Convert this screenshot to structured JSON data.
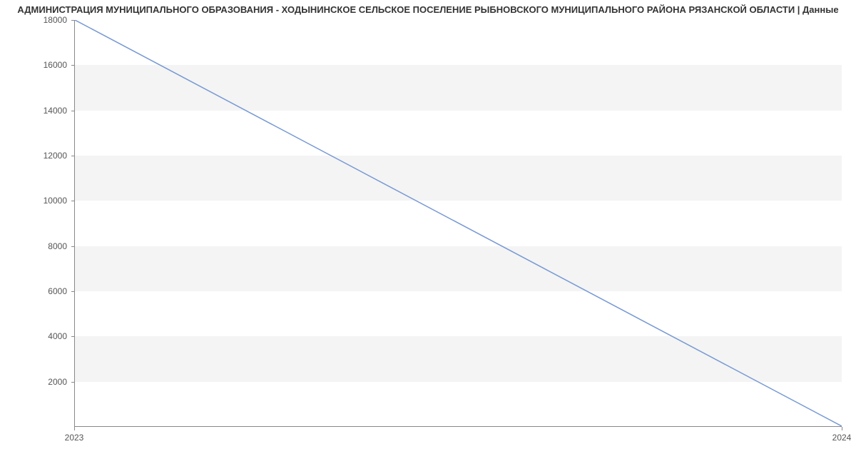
{
  "title": "АДМИНИСТРАЦИЯ МУНИЦИПАЛЬНОГО ОБРАЗОВАНИЯ - ХОДЫНИНСКОЕ СЕЛЬСКОЕ ПОСЕЛЕНИЕ РЫБНОВСКОГО МУНИЦИПАЛЬНОГО РАЙОНА РЯЗАНСКОЙ ОБЛАСТИ | Данные",
  "chart_data": {
    "type": "line",
    "x": [
      2023,
      2024
    ],
    "values": [
      18000,
      0
    ],
    "xlabel": "",
    "ylabel": "",
    "xlim": [
      2023,
      2024
    ],
    "ylim": [
      0,
      18000
    ],
    "y_ticks": [
      2000,
      4000,
      6000,
      8000,
      10000,
      12000,
      14000,
      16000,
      18000
    ],
    "x_ticks": [
      2023,
      2024
    ],
    "bands": [
      [
        2000,
        4000
      ],
      [
        6000,
        8000
      ],
      [
        10000,
        12000
      ],
      [
        14000,
        16000
      ]
    ],
    "line_color": "#7699d4"
  }
}
